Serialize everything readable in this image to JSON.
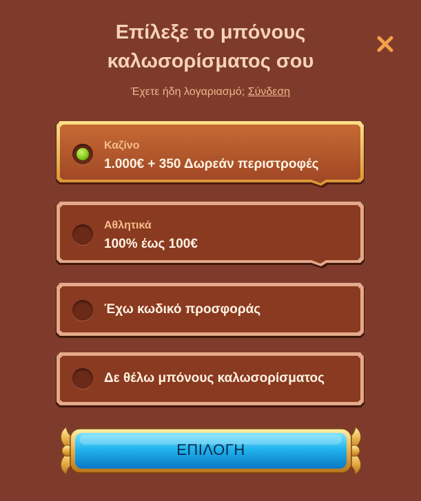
{
  "header": {
    "title_line1": "Επίλεξε το μπόνους",
    "title_line2": "καλωσορίσματος σου",
    "subtitle_prefix": "Έχετε ήδη λογαριασμό;",
    "login_link": "Σύνδεση"
  },
  "options": [
    {
      "label": "Καζίνο",
      "value": "1.000€ + 350 Δωρεάν περιστροφές",
      "selected": true
    },
    {
      "label": "Αθλητικά",
      "value": "100% έως 100€",
      "selected": false
    },
    {
      "label": "",
      "value": "Έχω κωδικό προσφοράς",
      "selected": false
    },
    {
      "label": "",
      "value": "Δε θέλω μπόνους καλωσορίσματος",
      "selected": false
    }
  ],
  "cta": {
    "label": "ΕΠΙΛΟΓΗ"
  },
  "colors": {
    "background": "#7e3b2b",
    "card": "#8a3a20",
    "card_selected": "#b5582d",
    "gold": "#e9b05a",
    "cta_blue": "#1aa9e6",
    "close": "#f5a04a"
  },
  "icons": {
    "close": "close-icon"
  }
}
